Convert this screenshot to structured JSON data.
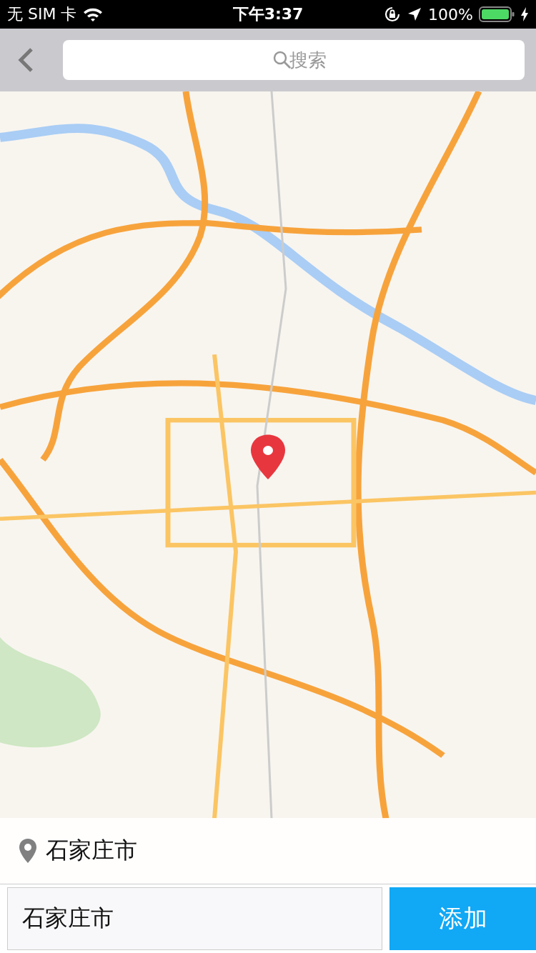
{
  "status_bar": {
    "carrier": "无 SIM 卡",
    "time": "下午3:37",
    "battery": "100%"
  },
  "search": {
    "placeholder": "搜索"
  },
  "location": {
    "name": "石家庄市"
  },
  "input": {
    "value": "石家庄市"
  },
  "add_button": {
    "label": "添加"
  }
}
